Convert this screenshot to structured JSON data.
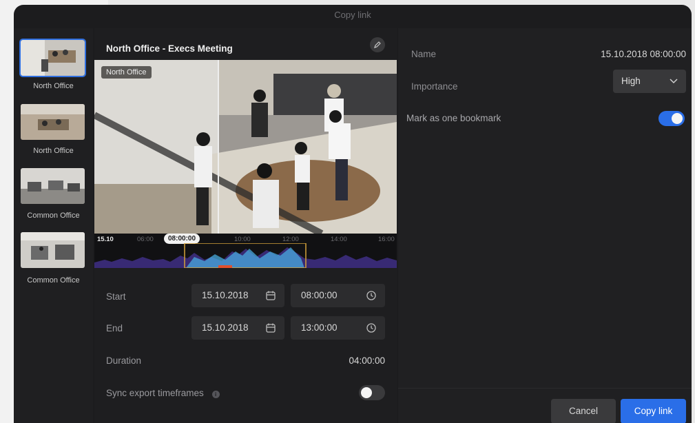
{
  "window": {
    "title": "Copy link"
  },
  "sidebar": {
    "cameras": [
      {
        "label": "North Office",
        "selected": true
      },
      {
        "label": "North Office",
        "selected": false
      },
      {
        "label": "Common Office",
        "selected": false
      },
      {
        "label": "Common Office",
        "selected": false
      }
    ]
  },
  "camera": {
    "title": "North Office - Execs Meeting",
    "badge": "North Office"
  },
  "timeline": {
    "date": "15.10",
    "ticks": [
      "06:00",
      "10:00",
      "12:00",
      "14:00",
      "16:00"
    ],
    "current_time": "08:00:00"
  },
  "form": {
    "start": {
      "label": "Start",
      "date": "15.10.2018",
      "time": "08:00:00"
    },
    "end": {
      "label": "End",
      "date": "15.10.2018",
      "time": "13:00:00"
    },
    "duration": {
      "label": "Duration",
      "value": "04:00:00"
    },
    "sync": {
      "label": "Sync export timeframes",
      "enabled": false
    }
  },
  "details": {
    "name": {
      "label": "Name",
      "value": "15.10.2018 08:00:00"
    },
    "importance": {
      "label": "Importance",
      "value": "High"
    },
    "one_bookmark": {
      "label": "Mark as one bookmark",
      "enabled": true
    }
  },
  "footer": {
    "cancel_label": "Cancel",
    "primary_label": "Copy link"
  },
  "colors": {
    "accent": "#2a6ee8",
    "timeline_wave": "#7a5cf0"
  }
}
